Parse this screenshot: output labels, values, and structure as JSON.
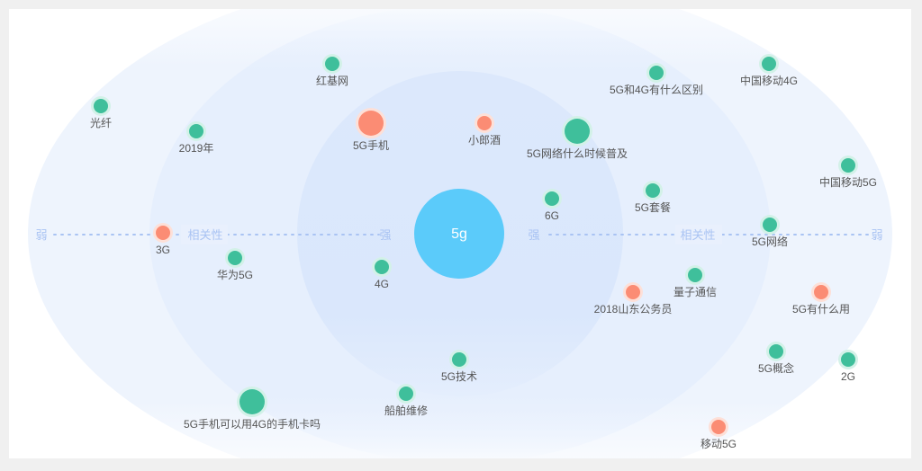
{
  "center": {
    "label": "5g",
    "color": "#5bcbfa"
  },
  "axis": {
    "weak": "弱",
    "strong": "强",
    "relevance": "相关性"
  },
  "colors": {
    "green": "#3fbf9b",
    "orange": "#fb8c74",
    "halo_green": "#d3f1e8",
    "halo_orange": "#fde0d8",
    "axis": "#a9c3f3"
  },
  "keywords": [
    {
      "label": "红基网",
      "color": "green",
      "size": "small"
    },
    {
      "label": "光纤",
      "color": "green",
      "size": "small"
    },
    {
      "label": "2019年",
      "color": "green",
      "size": "small"
    },
    {
      "label": "5G手机",
      "color": "orange",
      "size": "large"
    },
    {
      "label": "小郎酒",
      "color": "orange",
      "size": "small"
    },
    {
      "label": "5G网络什么时候普及",
      "color": "green",
      "size": "large"
    },
    {
      "label": "5G和4G有什么区别",
      "color": "green",
      "size": "small"
    },
    {
      "label": "中国移动4G",
      "color": "green",
      "size": "small"
    },
    {
      "label": "中国移动5G",
      "color": "green",
      "size": "small"
    },
    {
      "label": "6G",
      "color": "green",
      "size": "small"
    },
    {
      "label": "5G套餐",
      "color": "green",
      "size": "small"
    },
    {
      "label": "5G网络",
      "color": "green",
      "size": "small"
    },
    {
      "label": "3G",
      "color": "orange",
      "size": "small"
    },
    {
      "label": "华为5G",
      "color": "green",
      "size": "small"
    },
    {
      "label": "4G",
      "color": "green",
      "size": "small"
    },
    {
      "label": "量子通信",
      "color": "green",
      "size": "small"
    },
    {
      "label": "2018山东公务员",
      "color": "orange",
      "size": "small"
    },
    {
      "label": "5G有什么用",
      "color": "orange",
      "size": "small"
    },
    {
      "label": "5G技术",
      "color": "green",
      "size": "small"
    },
    {
      "label": "5G概念",
      "color": "green",
      "size": "small"
    },
    {
      "label": "2G",
      "color": "green",
      "size": "small"
    },
    {
      "label": "5G手机可以用4G的手机卡吗",
      "color": "green",
      "size": "large"
    },
    {
      "label": "船舶维修",
      "color": "green",
      "size": "small"
    },
    {
      "label": "移动5G",
      "color": "orange",
      "size": "small"
    }
  ]
}
